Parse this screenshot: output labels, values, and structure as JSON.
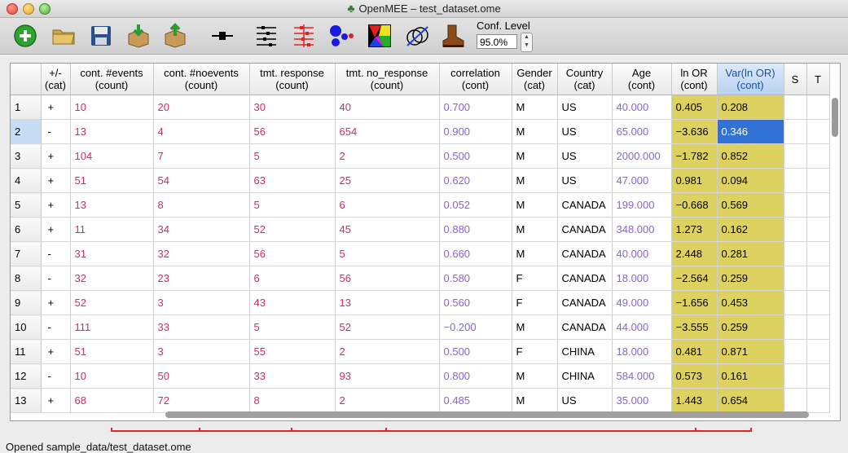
{
  "window": {
    "title": "OpenMEE – test_dataset.ome"
  },
  "toolbar": {
    "buttons": [
      {
        "name": "add-icon"
      },
      {
        "name": "open-folder-icon"
      },
      {
        "name": "save-disk-icon"
      },
      {
        "name": "import-icon"
      },
      {
        "name": "export-icon"
      },
      {
        "name": "forest-plot-icon"
      },
      {
        "name": "subgroup-forest-icon"
      },
      {
        "name": "meta-regression-icon"
      },
      {
        "name": "bubble-plot-icon"
      },
      {
        "name": "funnel-plot-icon"
      },
      {
        "name": "network-icon"
      },
      {
        "name": "boot-icon"
      }
    ],
    "conf_label": "Conf. Level",
    "conf_value": "95.0%"
  },
  "table": {
    "columns": [
      {
        "l1": "",
        "l2": ""
      },
      {
        "l1": "+/-",
        "l2": "(cat)"
      },
      {
        "l1": "cont. #events",
        "l2": "(count)"
      },
      {
        "l1": "cont. #noevents",
        "l2": "(count)"
      },
      {
        "l1": "tmt. response",
        "l2": "(count)"
      },
      {
        "l1": "tmt. no_response",
        "l2": "(count)"
      },
      {
        "l1": "correlation",
        "l2": "(cont)"
      },
      {
        "l1": "Gender",
        "l2": "(cat)"
      },
      {
        "l1": "Country",
        "l2": "(cat)"
      },
      {
        "l1": "Age",
        "l2": "(cont)"
      },
      {
        "l1": "ln OR",
        "l2": "(cont)"
      },
      {
        "l1": "Var(ln OR)",
        "l2": "(cont)"
      },
      {
        "l1": "S",
        "l2": ""
      },
      {
        "l1": "T",
        "l2": ""
      }
    ],
    "rows": [
      [
        "1",
        "+",
        "10",
        "20",
        "30",
        "40",
        "0.700",
        "M",
        "US",
        "40.000",
        "0.405",
        "0.208",
        "",
        ""
      ],
      [
        "2",
        "-",
        "13",
        "4",
        "56",
        "654",
        "0.900",
        "M",
        "US",
        "65.000",
        "-3.636",
        "0.346",
        "",
        ""
      ],
      [
        "3",
        "+",
        "104",
        "7",
        "5",
        "2",
        "0.500",
        "M",
        "US",
        "2000.000",
        "-1.782",
        "0.852",
        "",
        ""
      ],
      [
        "4",
        "+",
        "51",
        "54",
        "63",
        "25",
        "0.620",
        "M",
        "US",
        "47.000",
        "0.981",
        "0.094",
        "",
        ""
      ],
      [
        "5",
        "+",
        "13",
        "8",
        "5",
        "6",
        "0.052",
        "M",
        "CANADA",
        "199.000",
        "-0.668",
        "0.569",
        "",
        ""
      ],
      [
        "6",
        "+",
        "11",
        "34",
        "52",
        "45",
        "0.880",
        "M",
        "CANADA",
        "348.000",
        "1.273",
        "0.162",
        "",
        ""
      ],
      [
        "7",
        "-",
        "31",
        "32",
        "56",
        "5",
        "0.660",
        "M",
        "CANADA",
        "40.000",
        "2.448",
        "0.281",
        "",
        ""
      ],
      [
        "8",
        "-",
        "32",
        "23",
        "6",
        "56",
        "0.580",
        "F",
        "CANADA",
        "18.000",
        "-2.564",
        "0.259",
        "",
        ""
      ],
      [
        "9",
        "+",
        "52",
        "3",
        "43",
        "13",
        "0.560",
        "F",
        "CANADA",
        "49.000",
        "-1.656",
        "0.453",
        "",
        ""
      ],
      [
        "10",
        "-",
        "111",
        "33",
        "5",
        "52",
        "-0.200",
        "M",
        "CANADA",
        "44.000",
        "-3.555",
        "0.259",
        "",
        ""
      ],
      [
        "11",
        "+",
        "51",
        "3",
        "55",
        "2",
        "0.500",
        "F",
        "CHINA",
        "18.000",
        "0.481",
        "0.871",
        "",
        ""
      ],
      [
        "12",
        "-",
        "10",
        "50",
        "33",
        "93",
        "0.800",
        "M",
        "CHINA",
        "584.000",
        "0.573",
        "0.161",
        "",
        ""
      ],
      [
        "13",
        "+",
        "68",
        "72",
        "8",
        "2",
        "0.485",
        "M",
        "US",
        "35.000",
        "1.443",
        "0.654",
        "",
        ""
      ]
    ],
    "selected_row": 2,
    "selected_column": "Var(ln OR)"
  },
  "status": {
    "text": "Opened sample_data/test_dataset.ome"
  },
  "colors": {
    "count": "#d42a63",
    "cont": "#8a63d2",
    "effect_bg": "#ddd260",
    "selection": "#3272d6"
  }
}
